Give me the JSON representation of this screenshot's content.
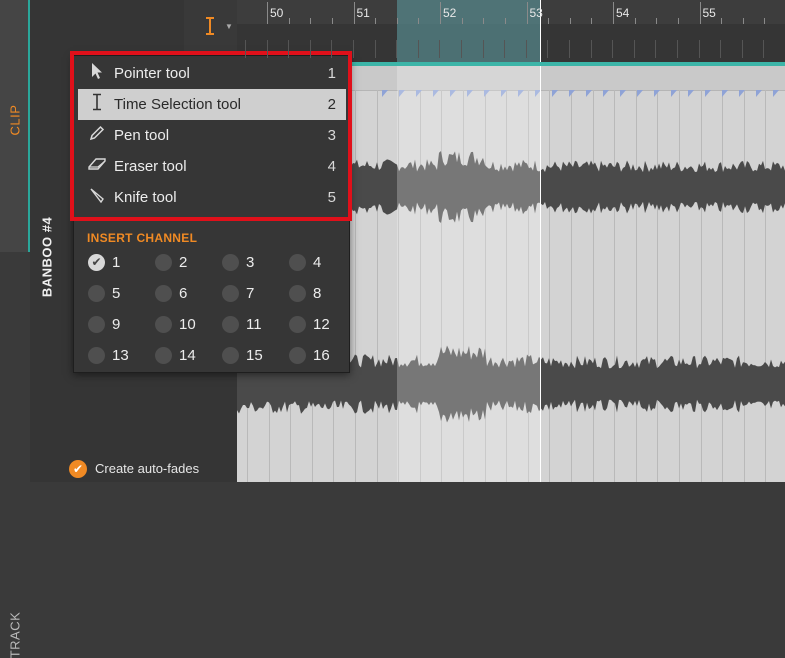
{
  "left_tabs": {
    "clip": "CLIP",
    "track": "TRACK"
  },
  "track": {
    "name": "BANBOO #4"
  },
  "ruler": {
    "bars": [
      "50",
      "51",
      "52",
      "53",
      "54",
      "55"
    ]
  },
  "tool_menu": {
    "items": [
      {
        "label": "Pointer tool",
        "shortcut": "1",
        "icon": "pointer-icon",
        "active": false
      },
      {
        "label": "Time Selection tool",
        "shortcut": "2",
        "icon": "time-selection-icon",
        "active": true
      },
      {
        "label": "Pen tool",
        "shortcut": "3",
        "icon": "pen-icon",
        "active": false
      },
      {
        "label": "Eraser tool",
        "shortcut": "4",
        "icon": "eraser-icon",
        "active": false
      },
      {
        "label": "Knife tool",
        "shortcut": "5",
        "icon": "knife-icon",
        "active": false
      }
    ],
    "insert_channel": {
      "title": "INSERT CHANNEL",
      "channels": [
        "1",
        "2",
        "3",
        "4",
        "5",
        "6",
        "7",
        "8",
        "9",
        "10",
        "11",
        "12",
        "13",
        "14",
        "15",
        "16"
      ],
      "selected": "1"
    }
  },
  "autofade": {
    "label": "Create auto-fades",
    "checked": true
  },
  "colors": {
    "accent": "#f08a24",
    "teal": "#3cb5a8",
    "highlight": "#e0101a"
  }
}
